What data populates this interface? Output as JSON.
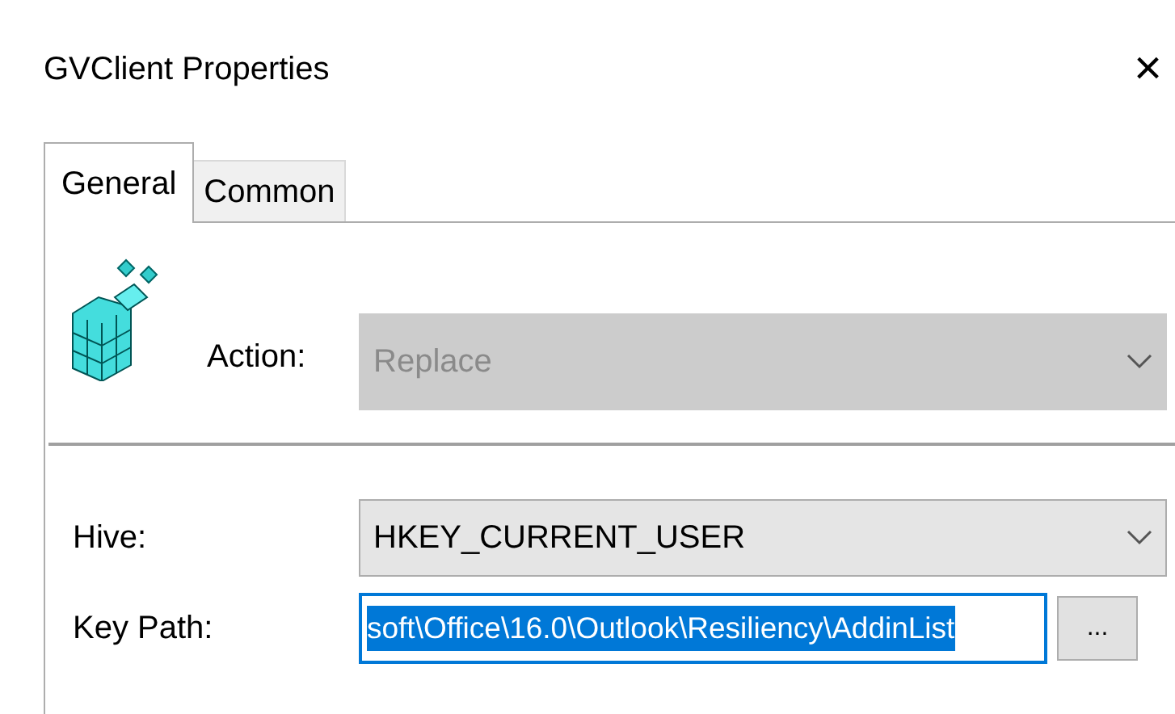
{
  "window": {
    "title": "GVClient Properties",
    "close": "×"
  },
  "tabs": [
    {
      "label": "General",
      "selected": true
    },
    {
      "label": "Common",
      "selected": false
    }
  ],
  "action": {
    "label": "Action:",
    "value": "Replace",
    "disabled": true
  },
  "hive": {
    "label": "Hive:",
    "value": "HKEY_CURRENT_USER",
    "disabled": false
  },
  "key_path": {
    "label": "Key Path:",
    "value": "soft\\Office\\16.0\\Outlook\\Resiliency\\AddinList",
    "text_selected": true,
    "browse": "..."
  }
}
